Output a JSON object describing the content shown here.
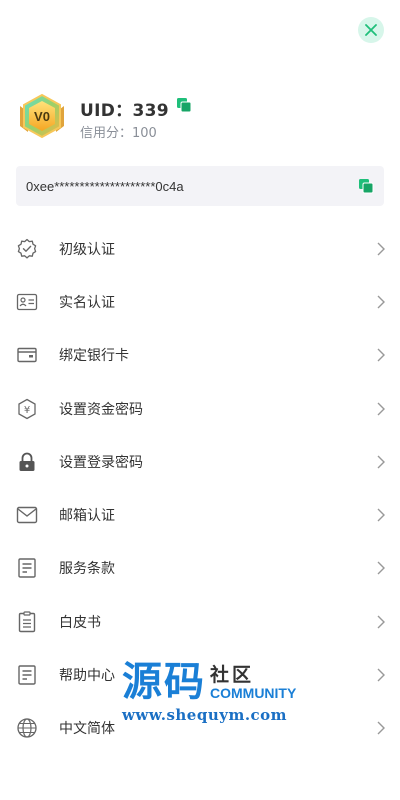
{
  "header": {
    "close_icon": "close-icon"
  },
  "profile": {
    "badge_text": "V0",
    "uid_text": "UID：339",
    "credit_text": "信用分：100"
  },
  "wallet": {
    "address": "0xee********************0c4a"
  },
  "menu": {
    "items": [
      {
        "label": "初级认证",
        "icon": "verified-badge-icon"
      },
      {
        "label": "实名认证",
        "icon": "id-card-icon"
      },
      {
        "label": "绑定银行卡",
        "icon": "wallet-card-icon"
      },
      {
        "label": "设置资金密码",
        "icon": "yen-shield-icon"
      },
      {
        "label": "设置登录密码",
        "icon": "lock-icon"
      },
      {
        "label": "邮箱认证",
        "icon": "mail-icon"
      },
      {
        "label": "服务条款",
        "icon": "document-icon"
      },
      {
        "label": "白皮书",
        "icon": "clipboard-icon"
      },
      {
        "label": "帮助中心",
        "icon": "help-document-icon"
      },
      {
        "label": "中文简体",
        "icon": "globe-icon"
      }
    ]
  },
  "watermark": {
    "big": "源码",
    "small": "社区",
    "community": "COMMUNITY",
    "url": "www.shequym.com"
  },
  "colors": {
    "accent": "#1fbf7a",
    "close_bg": "#d7f6ea",
    "address_bg": "#f3f3f7",
    "muted": "#8a8f98"
  }
}
